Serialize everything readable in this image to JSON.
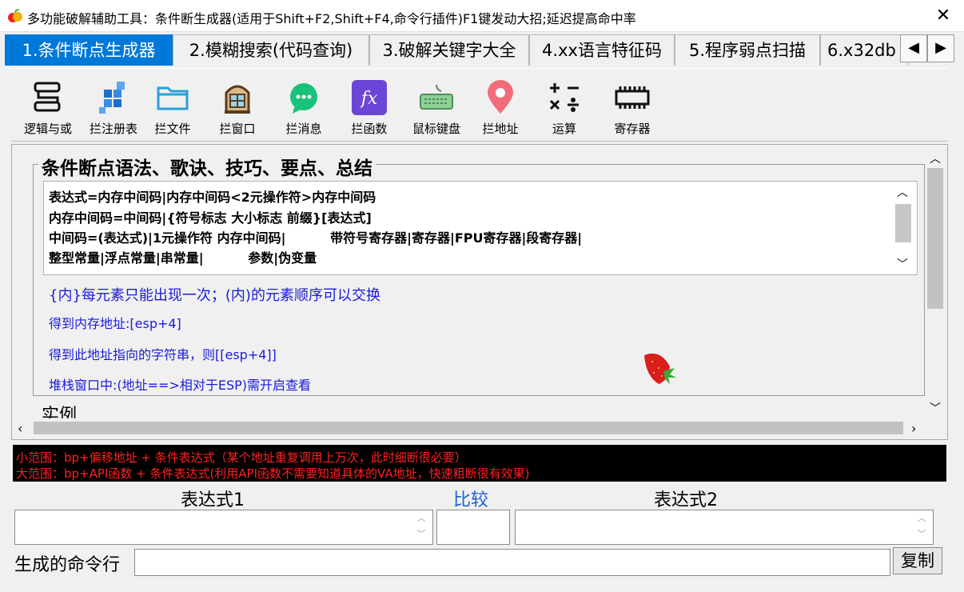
{
  "window": {
    "title": "多功能破解辅助工具：条件断生成器(适用于Shift+F2,Shift+F4,命令行插件)F1键发动大招;延迟提高命中率",
    "close_glyph": "✕"
  },
  "tabs": [
    {
      "label": "1.条件断点生成器",
      "active": true
    },
    {
      "label": "2.模糊搜索(代码查询)",
      "active": false
    },
    {
      "label": "3.破解关键字大全",
      "active": false
    },
    {
      "label": "4.xx语言特征码",
      "active": false
    },
    {
      "label": "5.程序弱点扫描",
      "active": false
    },
    {
      "label": "6.x32db",
      "active": false
    }
  ],
  "tab_scroll": {
    "left": "◀",
    "right": "▶"
  },
  "toolbar": [
    {
      "label": "逻辑与或",
      "icon": "logic-icon"
    },
    {
      "label": "拦注册表",
      "icon": "registry-icon"
    },
    {
      "label": "拦文件",
      "icon": "folder-icon"
    },
    {
      "label": "拦窗口",
      "icon": "window-icon"
    },
    {
      "label": "拦消息",
      "icon": "message-icon"
    },
    {
      "label": "拦函数",
      "icon": "function-icon"
    },
    {
      "label": "鼠标键盘",
      "icon": "keyboard-icon"
    },
    {
      "label": "拦地址",
      "icon": "location-icon"
    },
    {
      "label": "运算",
      "icon": "calculator-icon"
    },
    {
      "label": "寄存器",
      "icon": "chip-icon"
    }
  ],
  "syntax_section": {
    "title": "条件断点语法、歌诀、技巧、要点、总结",
    "lines": [
      "表达式=内存中间码|内存中间码<2元操作符>内存中间码",
      "内存中间码=中间码|{符号标志 大小标志 前缀}[表达式]",
      "中间码=(表达式)|1元操作符 内存中间码|          带符号寄存器|寄存器|FPU寄存器|段寄存器|",
      "整型常量|浮点常量|串常量|          参数|伪变量"
    ],
    "notes": [
      "{内}每元素只能出现一次；(内)的元素顺序可以交换",
      "得到内存地址:[esp+4]",
      "得到此地址指向的字符串，则[[esp+4]]",
      "堆栈窗口中:(地址==>相对于ESP)需开启查看"
    ]
  },
  "example_section": {
    "title": "实例"
  },
  "hints": [
    "小范围：bp+偏移地址 + 条件表达式（某个地址重复调用上万次，此时细断很必要）",
    "大范围：bp+API函数  + 条件表达式(利用API函数不需要知道具体的VA地址，快速粗断很有效果)"
  ],
  "form": {
    "expr1_label": "表达式1",
    "compare_label": "比较",
    "expr2_label": "表达式2",
    "expr1_value": "",
    "compare_value": "",
    "expr2_value": "",
    "command_label": "生成的命令行",
    "command_value": "",
    "copy_label": "复制"
  },
  "colors": {
    "accent": "#0078d7",
    "note": "#1b1bd8",
    "hint": "#ff2020",
    "hint_bg": "#000000"
  }
}
